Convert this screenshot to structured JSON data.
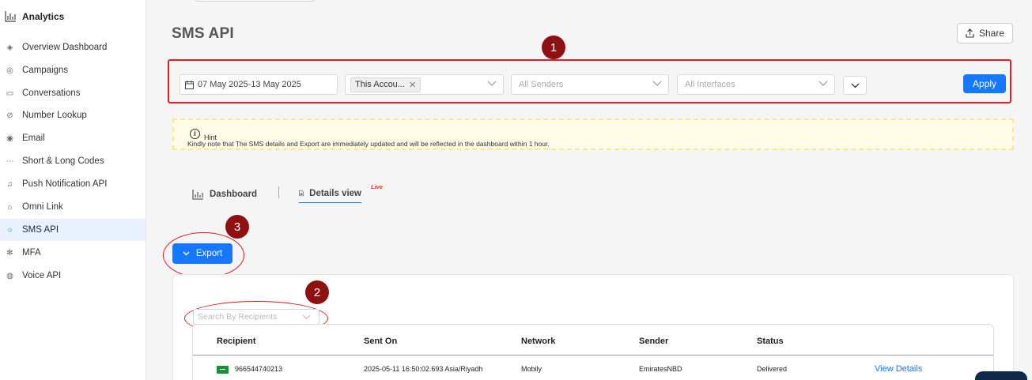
{
  "sidebar": {
    "title": "Analytics",
    "items": [
      {
        "label": "Overview Dashboard",
        "icon": "layers-icon",
        "glyph": "◈",
        "active": false
      },
      {
        "label": "Campaigns",
        "icon": "campaign-icon",
        "glyph": "◎",
        "active": false
      },
      {
        "label": "Conversations",
        "icon": "chat-icon",
        "glyph": "▭",
        "active": false
      },
      {
        "label": "Number Lookup",
        "icon": "lookup-icon",
        "glyph": "⊘",
        "active": false
      },
      {
        "label": "Email",
        "icon": "email-icon",
        "glyph": "◉",
        "active": false
      },
      {
        "label": "Short & Long Codes",
        "icon": "codes-icon",
        "glyph": "⋯",
        "active": false
      },
      {
        "label": "Push Notification API",
        "icon": "bell-icon",
        "glyph": "♫",
        "active": false
      },
      {
        "label": "Omni Link",
        "icon": "omni-link-icon",
        "glyph": "⌂",
        "active": false
      },
      {
        "label": "SMS API",
        "icon": "sms-chat-icon",
        "glyph": "○",
        "active": true
      },
      {
        "label": "MFA",
        "icon": "mfa-icon",
        "glyph": "✻",
        "active": false
      },
      {
        "label": "Voice API",
        "icon": "voice-icon",
        "glyph": "◍",
        "active": false
      }
    ]
  },
  "header": {
    "title": "SMS API",
    "share_label": "Share"
  },
  "filters": {
    "date_range": "07 May 2025-13 May 2025",
    "account_chip": "This Accou...",
    "senders_placeholder": "All Senders",
    "interfaces_placeholder": "All Interfaces",
    "apply_label": "Apply"
  },
  "hint": {
    "title": "Hint",
    "text": "Kindly note that The SMS details and Export are immediately updated and will be reflected in the dashboard within 1 hour."
  },
  "tabs": {
    "dashboard": "Dashboard",
    "details": "Details view",
    "live": "Live"
  },
  "export_label": "Export",
  "search_placeholder": "Search By Recipients",
  "annotations": {
    "badge1": "1",
    "badge2": "2",
    "badge3": "3"
  },
  "table": {
    "columns": [
      "Recipient",
      "Sent On",
      "Network",
      "Sender",
      "Status"
    ],
    "rows": [
      {
        "recipient": "966544740213",
        "sent_on": "2025-05-11 16:50:02.693 Asia/Riyadh",
        "network": "Mobily",
        "sender": "EmiratesNBD",
        "status": "Delivered",
        "action": "View Details"
      }
    ]
  },
  "colors": {
    "accent": "#1677ff",
    "annotation_red": "#e01e25",
    "badge": "#8e1010"
  }
}
